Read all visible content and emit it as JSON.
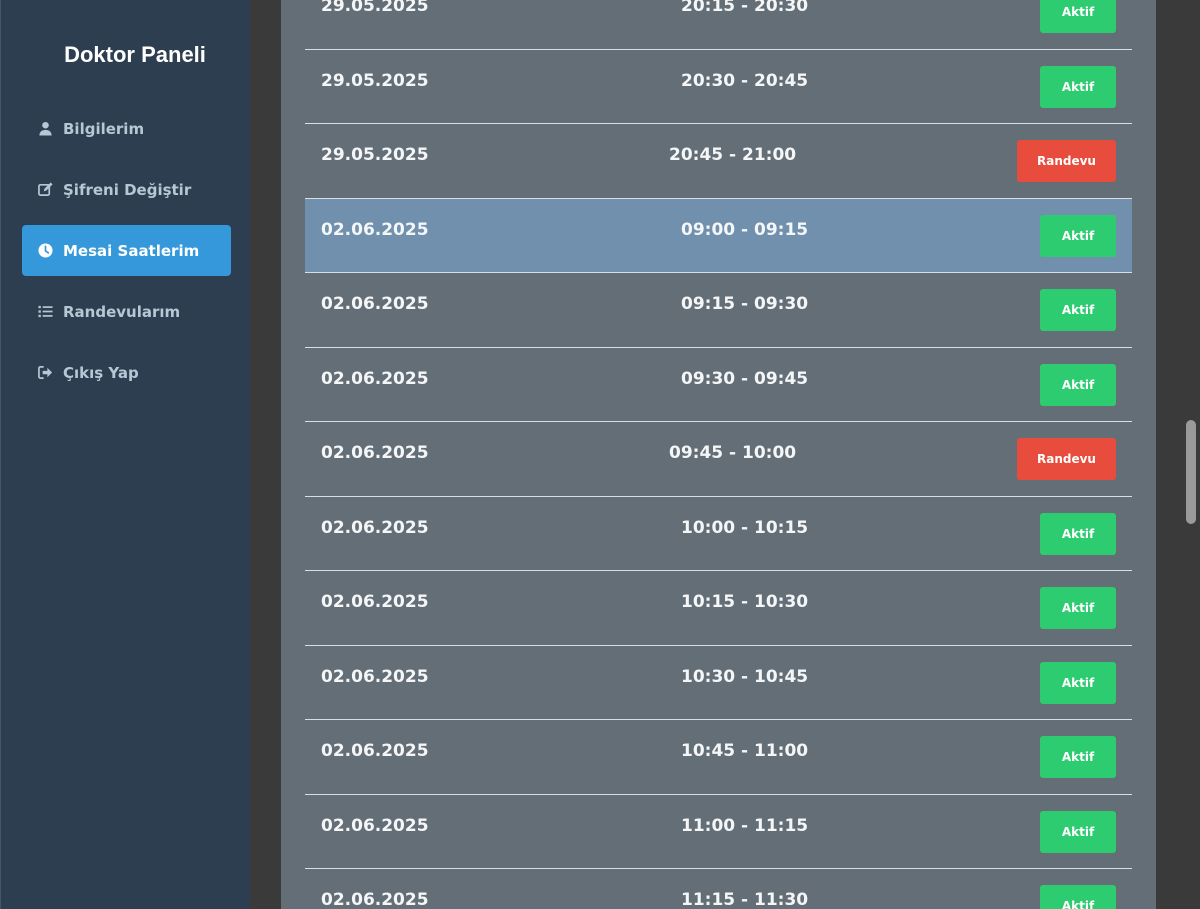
{
  "sidebar": {
    "title": "Doktor Paneli",
    "items": [
      {
        "label": "Bilgilerim",
        "icon": "user-icon"
      },
      {
        "label": "Şifreni Değiştir",
        "icon": "edit-icon"
      },
      {
        "label": "Mesai Saatlerim",
        "icon": "clock-icon",
        "active": true
      },
      {
        "label": "Randevularım",
        "icon": "list-icon"
      },
      {
        "label": "Çıkış Yap",
        "icon": "sign-out-icon"
      }
    ]
  },
  "slots": [
    {
      "date": "29.05.2025",
      "time": "20:15 - 20:30",
      "status": "Aktif"
    },
    {
      "date": "29.05.2025",
      "time": "20:30 - 20:45",
      "status": "Aktif"
    },
    {
      "date": "29.05.2025",
      "time": "20:45 - 21:00",
      "status": "Randevu"
    },
    {
      "date": "02.06.2025",
      "time": "09:00 - 09:15",
      "status": "Aktif"
    },
    {
      "date": "02.06.2025",
      "time": "09:15 - 09:30",
      "status": "Aktif"
    },
    {
      "date": "02.06.2025",
      "time": "09:30 - 09:45",
      "status": "Aktif"
    },
    {
      "date": "02.06.2025",
      "time": "09:45 - 10:00",
      "status": "Randevu"
    },
    {
      "date": "02.06.2025",
      "time": "10:00 - 10:15",
      "status": "Aktif"
    },
    {
      "date": "02.06.2025",
      "time": "10:15 - 10:30",
      "status": "Aktif"
    },
    {
      "date": "02.06.2025",
      "time": "10:30 - 10:45",
      "status": "Aktif"
    },
    {
      "date": "02.06.2025",
      "time": "10:45 - 11:00",
      "status": "Aktif"
    },
    {
      "date": "02.06.2025",
      "time": "11:00 - 11:15",
      "status": "Aktif"
    },
    {
      "date": "02.06.2025",
      "time": "11:15 - 11:30",
      "status": "Aktif"
    }
  ],
  "colors": {
    "sidebar_bg": "#2c3e50",
    "active_item": "#3498db",
    "card_bg": "#636e77",
    "highlight_row": "#7190ae",
    "aktif": "#2ecc71",
    "randevu": "#e74c3c"
  }
}
